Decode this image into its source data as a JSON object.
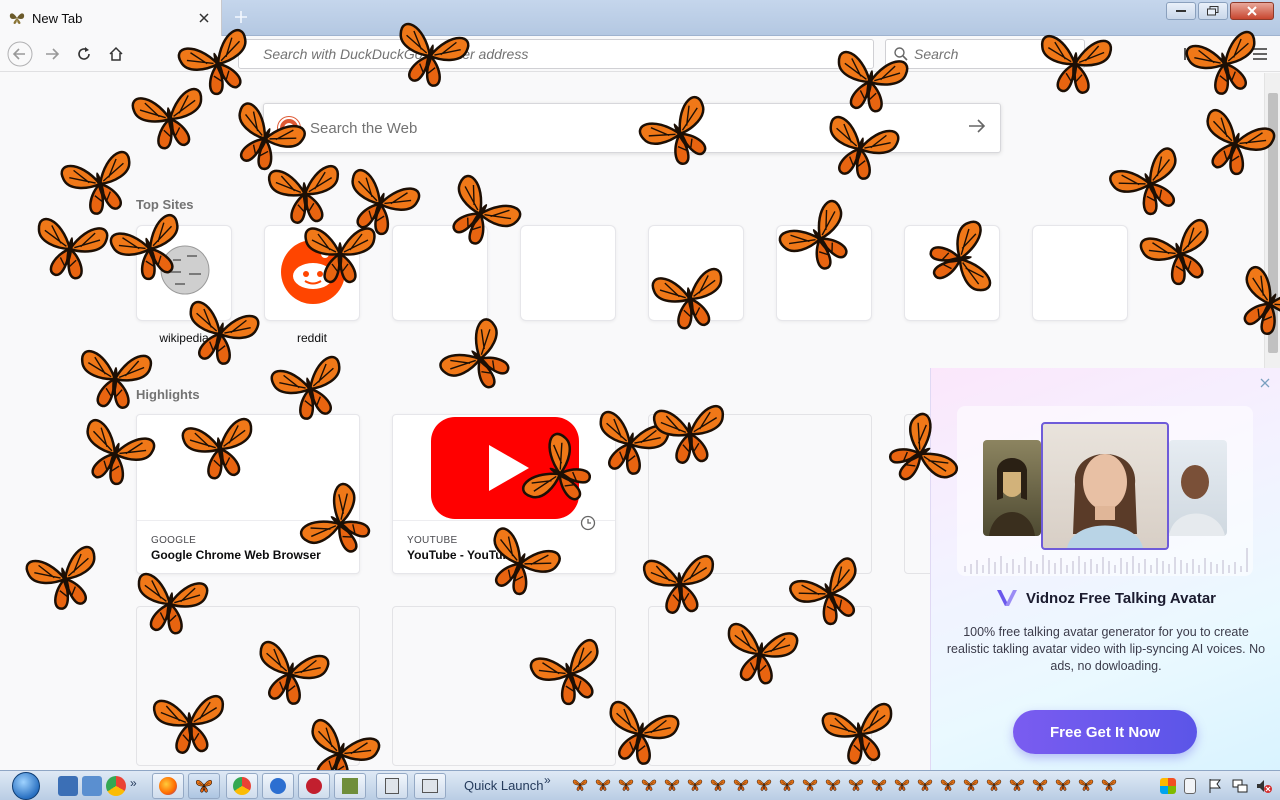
{
  "browser": {
    "tab_title": "New Tab",
    "url_placeholder": "Search with DuckDuckGo or enter address",
    "search_placeholder": "Search"
  },
  "newtab": {
    "web_search_placeholder": "Search the Web",
    "top_sites_heading": "Top Sites",
    "highlights_heading": "Highlights",
    "top_sites": [
      {
        "label": "wikipedia"
      },
      {
        "label": "reddit"
      }
    ],
    "highlights": [
      {
        "source": "GOOGLE",
        "title": "Google Chrome Web Browser"
      },
      {
        "source": "YOUTUBE",
        "title": "YouTube - YouTube"
      }
    ]
  },
  "ad": {
    "brand": "Vidnoz Free Talking Avatar",
    "description": "100% free talking avatar generator for you to create realistic takling avatar video with lip-syncing AI voices. No ads, no dowloading.",
    "cta": "Free Get It Now"
  },
  "taskbar": {
    "quick_launch": "Quick Launch"
  },
  "colors": {
    "butterfly_orange": "#f07818",
    "cta_purple": "#6a58ec",
    "youtube_red": "#ff0000",
    "reddit_orange": "#ff4500"
  }
}
